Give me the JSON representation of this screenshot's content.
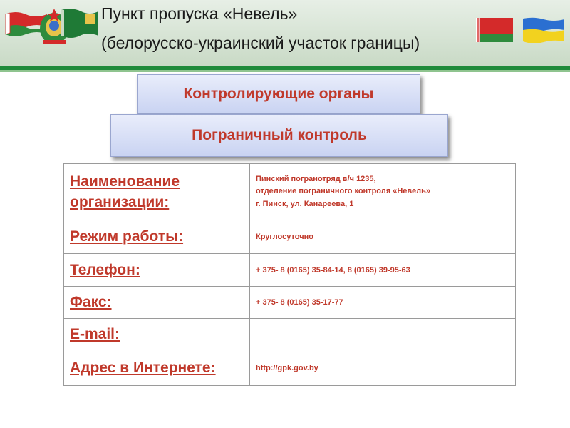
{
  "header": {
    "title": "Пункт пропуска «Невель»",
    "subtitle": "(белорусско-украинский участок границы)"
  },
  "boxes": {
    "top": "Контролирующие органы",
    "bottom": "Пограничный контроль"
  },
  "table": {
    "rows": [
      {
        "label_line1": "Наименование",
        "label_line2": "организации:",
        "value_lines": [
          "Пинский погранотряд в/ч 1235,",
          "отделение пограничного контроля «Невель»",
          "г. Пинск, ул. Канареева, 1"
        ]
      },
      {
        "label": "Режим работы:",
        "value": "Круглосуточно"
      },
      {
        "label": "Телефон:",
        "value": "+ 375- 8 (0165) 35-84-14, 8 (0165) 39-95-63"
      },
      {
        "label": "Факс:",
        "value": "+ 375- 8 (0165) 35-17-77"
      },
      {
        "label": "E-mail:",
        "value": ""
      },
      {
        "label": "Адрес в Интернете:",
        "value": "http://gpk.gov.by"
      }
    ]
  },
  "colors": {
    "accent": "#c0392b",
    "header_green": "#1f8a3a",
    "box_fill": "#d6ddf6"
  },
  "icons": [
    "belarus-flag-icon",
    "belarus-emblem-icon",
    "border-troops-flag-icon",
    "belarus-flag-icon",
    "ukraine-flag-icon"
  ]
}
